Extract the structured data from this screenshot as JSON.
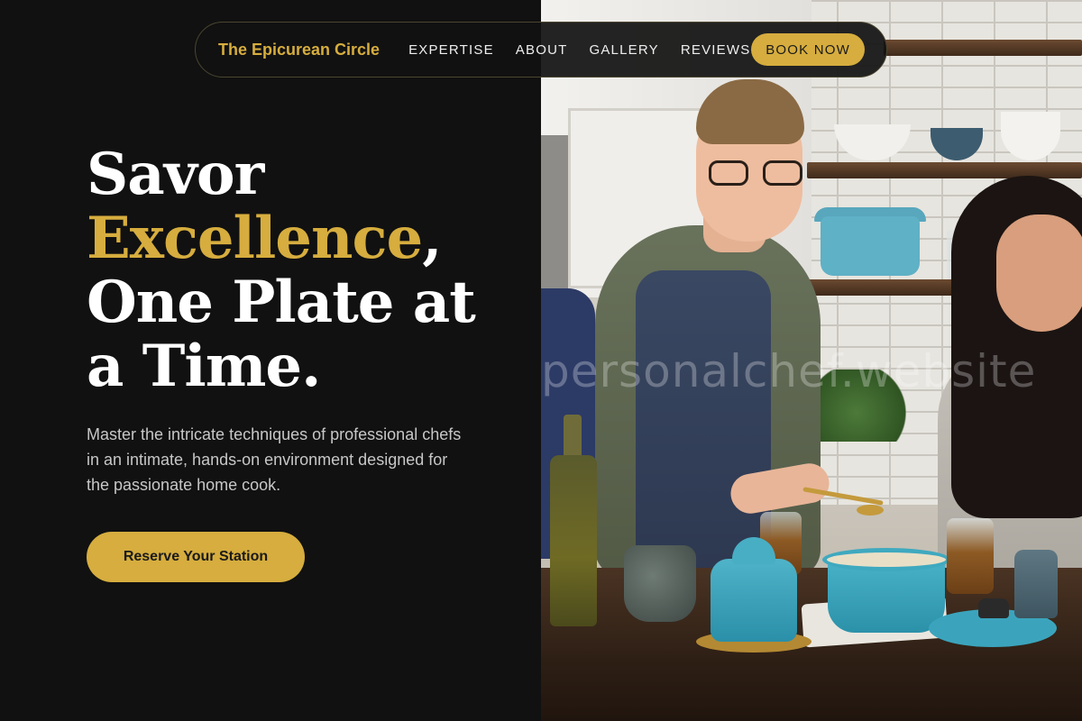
{
  "nav": {
    "brand": "The Epicurean Circle",
    "links": [
      "EXPERTISE",
      "ABOUT",
      "GALLERY",
      "REVIEWS"
    ],
    "cta": "BOOK NOW"
  },
  "hero": {
    "title_line1": "Savor",
    "title_accent": "Excellence",
    "title_comma": ",",
    "title_line3": "One Plate at",
    "title_line4": "a Time.",
    "body": "Master the intricate techniques of professional chefs in an intimate, hands-on environment designed for the passionate home cook.",
    "cta": "Reserve Your Station"
  },
  "image": {
    "watermark": "personalchef.website"
  },
  "colors": {
    "accent": "#d6ad3e",
    "background": "#111111",
    "text": "#ffffff",
    "body_text": "#c7c7c7"
  }
}
